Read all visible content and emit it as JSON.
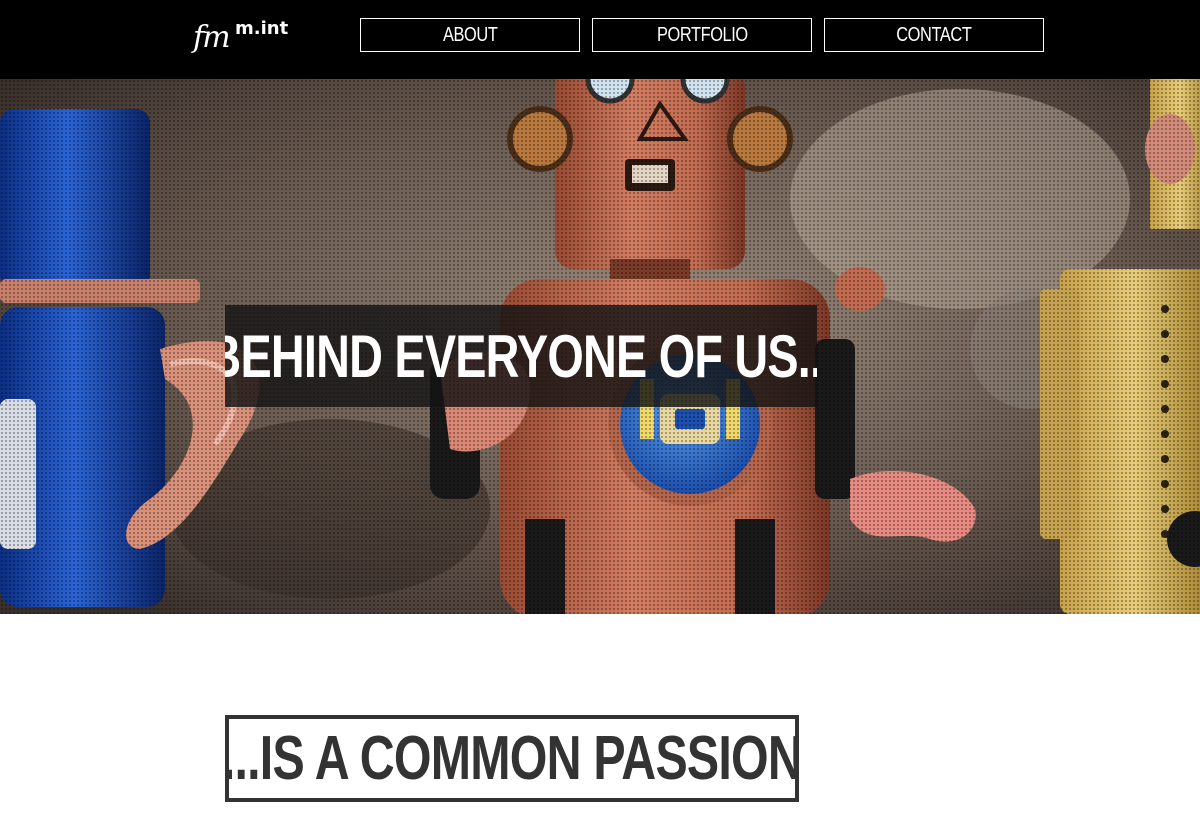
{
  "header": {
    "logo": {
      "mark": "fm",
      "superscript": "m.int"
    },
    "nav": [
      {
        "label": "ABOUT"
      },
      {
        "label": "PORTFOLIO"
      },
      {
        "label": "CONTACT"
      }
    ]
  },
  "hero": {
    "headline": "BEHIND EVERYONE OF US..."
  },
  "section": {
    "tagline": "...IS A COMMON PASSION"
  },
  "colors": {
    "header_bg": "#000000",
    "nav_text": "#ffffff",
    "tagline_text": "#333333",
    "headline_bg": "#141414"
  }
}
